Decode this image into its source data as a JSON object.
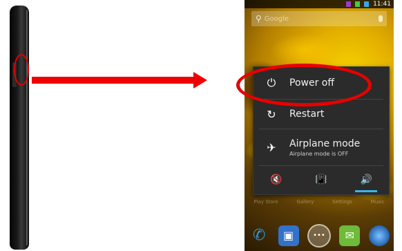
{
  "status_bar": {
    "time": "11:41"
  },
  "search": {
    "text": "Google"
  },
  "power_menu": {
    "power_off": {
      "label": "Power off",
      "icon": "power-icon"
    },
    "restart": {
      "label": "Restart",
      "icon": "restart-icon"
    },
    "airplane": {
      "label": "Airplane mode",
      "status": "Airplane mode is OFF",
      "icon": "airplane-icon"
    },
    "sound_modes": [
      {
        "icon": "silent-icon",
        "active": false
      },
      {
        "icon": "vibrate-icon",
        "active": false
      },
      {
        "icon": "sound-on-icon",
        "active": true
      }
    ]
  },
  "app_labels": [
    "Play Store",
    "Gallery",
    "Settings",
    "Music"
  ],
  "colors": {
    "highlight": "#e80000",
    "accent": "#3ab6e6",
    "dialog": "#2b2b2b"
  }
}
